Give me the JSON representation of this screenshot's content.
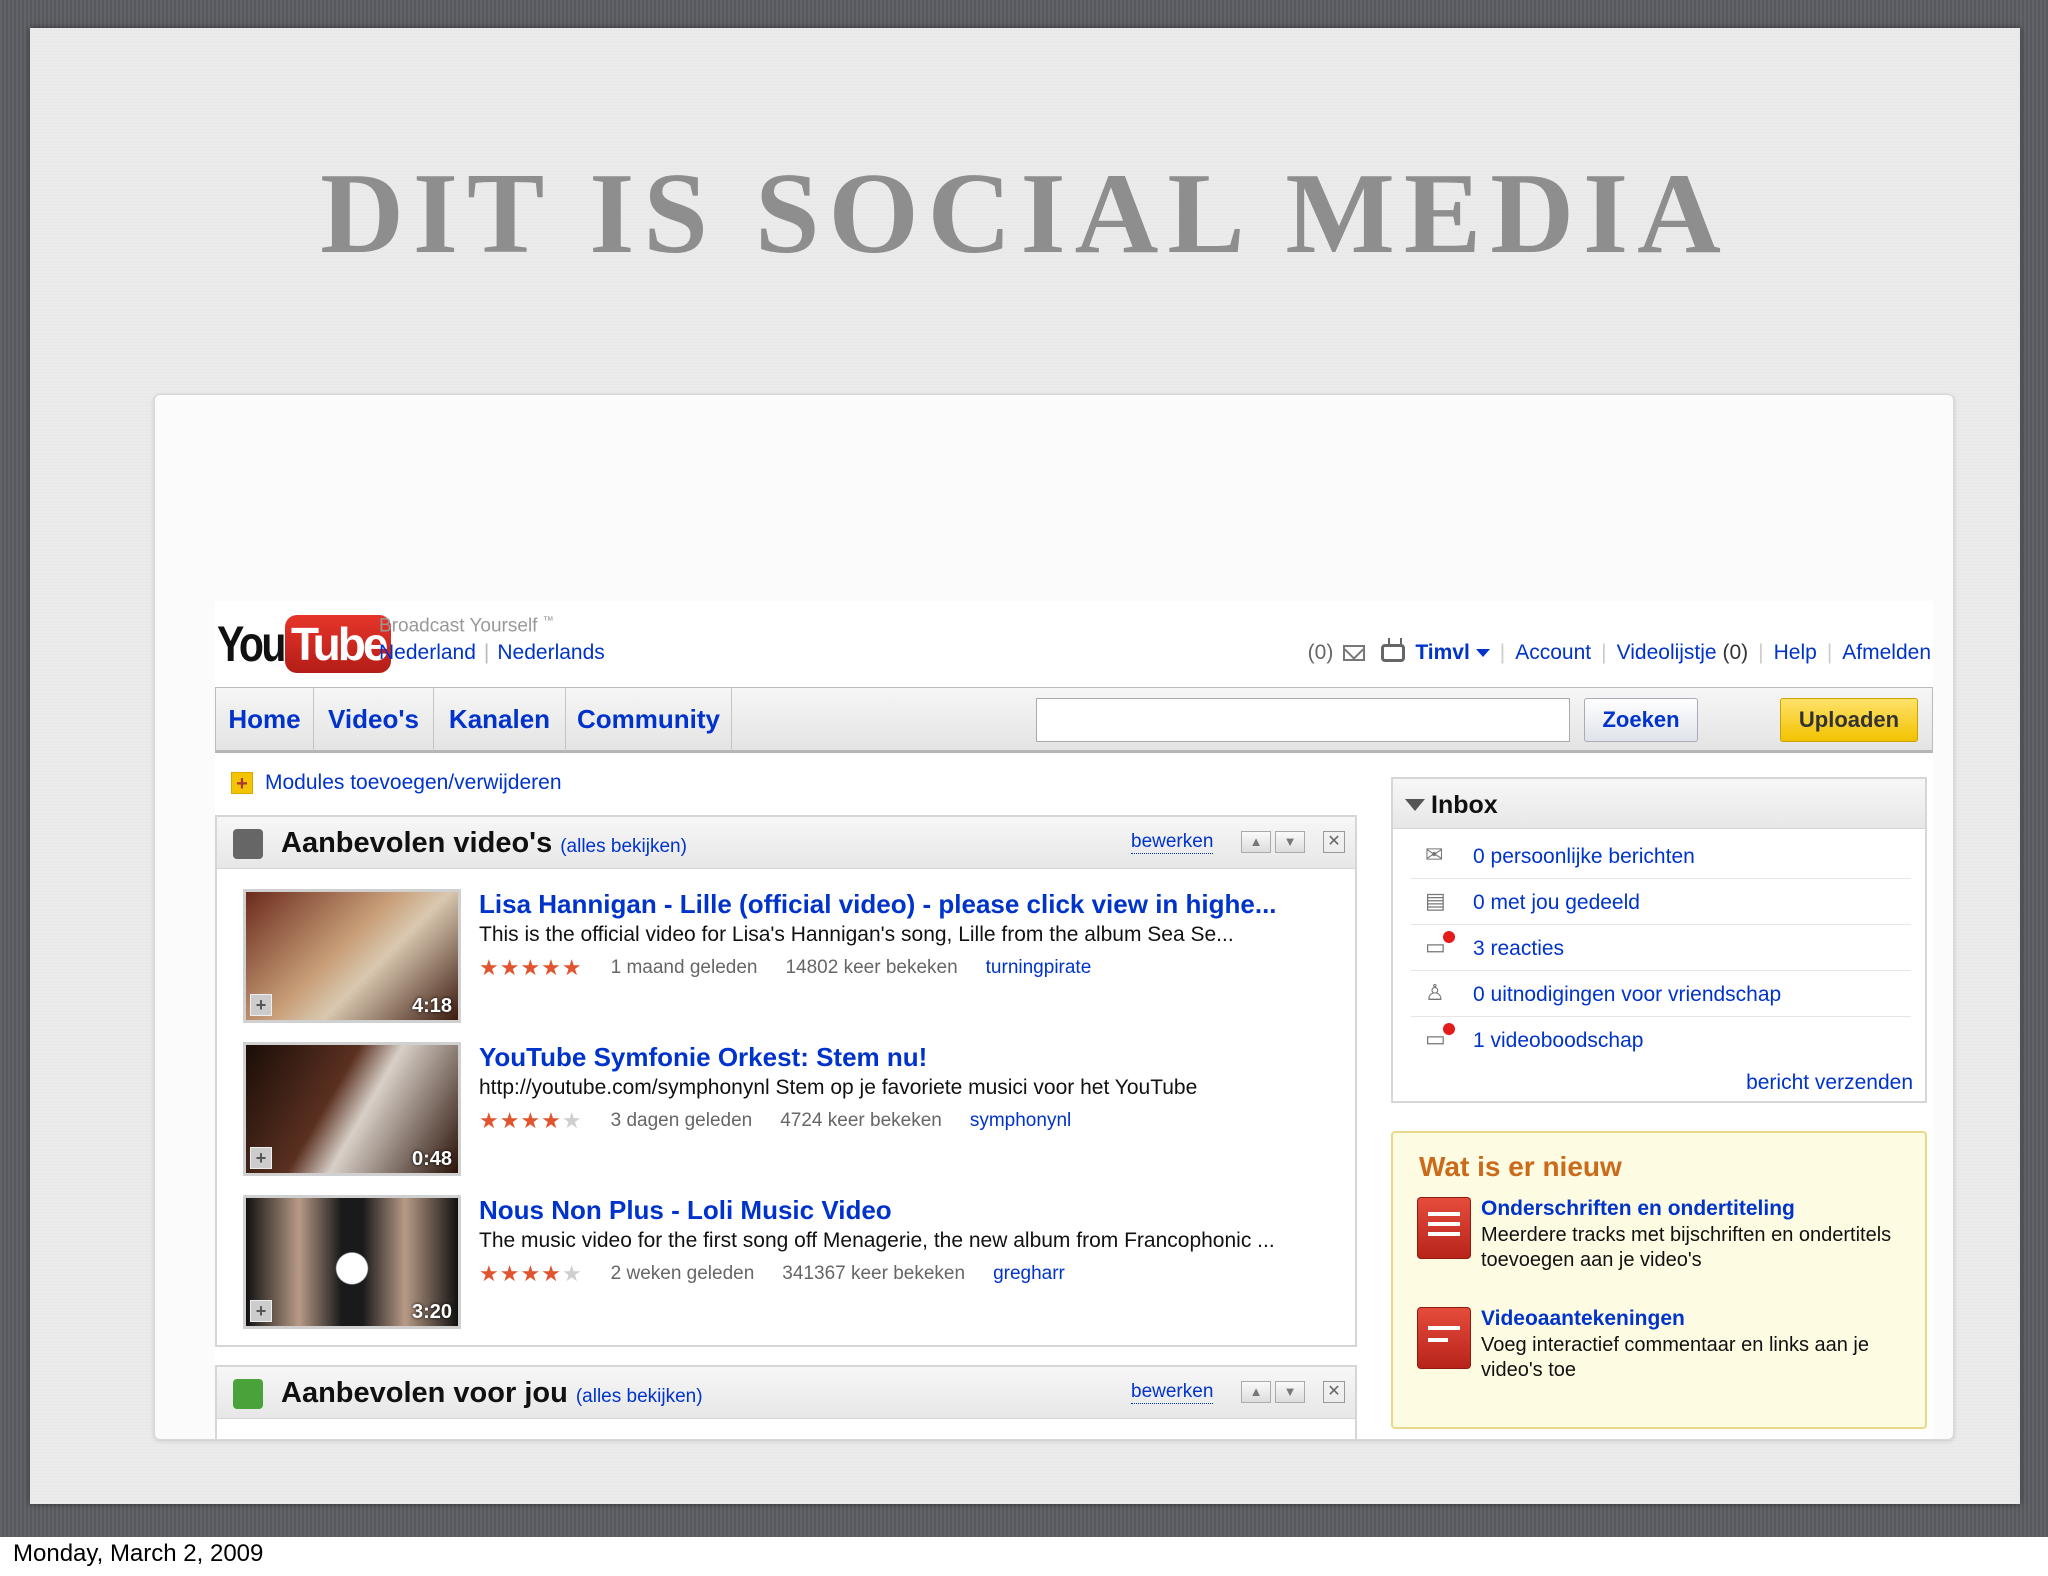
{
  "slide": {
    "title": "DIT IS SOCIAL MEDIA",
    "date": "Monday, March 2, 2009"
  },
  "header": {
    "logo": {
      "you": "You",
      "tube": "Tube"
    },
    "tagline": "Broadcast Yourself",
    "tagline_tm": "™",
    "country": "Nederland",
    "language": "Nederlands",
    "inbox_count": "(0)",
    "username": "Timvl",
    "account": "Account",
    "playlist": "Videolijstje",
    "playlist_count": "(0)",
    "help": "Help",
    "logout": "Afmelden"
  },
  "nav": {
    "tabs": [
      {
        "label": "Home"
      },
      {
        "label": "Video's"
      },
      {
        "label": "Kanalen"
      },
      {
        "label": "Community"
      }
    ],
    "search_value": "",
    "search_button": "Zoeken",
    "upload_button": "Uploaden"
  },
  "modules_link": "Modules toevoegen/verwijderen",
  "recommended": {
    "title": "Aanbevolen video's",
    "all": "(alles bekijken)",
    "edit": "bewerken",
    "videos": [
      {
        "title": "Lisa Hannigan - Lille (official video) - please click view in highe...",
        "desc": "This is the official video for Lisa's Hannigan's song, Lille from the album Sea Se...",
        "rating": 5,
        "age": "1 maand geleden",
        "views": "14802 keer bekeken",
        "user": "turningpirate",
        "duration": "4:18"
      },
      {
        "title": "YouTube Symfonie Orkest: Stem nu!",
        "desc": "http://youtube.com/symphonynl Stem op je favoriete musici voor het YouTube",
        "rating": 4.5,
        "age": "3 dagen geleden",
        "views": "4724 keer bekeken",
        "user": "symphonynl",
        "duration": "0:48"
      },
      {
        "title": "Nous Non Plus - Loli Music Video",
        "desc": "The music video for the first song off Menagerie, the new album from Francophonic ...",
        "rating": 4,
        "age": "2 weken geleden",
        "views": "341367 keer bekeken",
        "user": "gregharr",
        "duration": "3:20"
      }
    ]
  },
  "for_you": {
    "title": "Aanbevolen voor jou",
    "all": "(alles bekijken)",
    "edit": "bewerken"
  },
  "inbox": {
    "title": "Inbox",
    "rows": [
      {
        "icon": "envelope-icon",
        "text": "0 persoonlijke berichten"
      },
      {
        "icon": "shared-icon",
        "text": "0 met jou gedeeld"
      },
      {
        "icon": "comment-icon",
        "text": "3 reacties"
      },
      {
        "icon": "person-icon",
        "text": "0 uitnodigingen voor vriendschap"
      },
      {
        "icon": "comment-icon",
        "text": "1 videoboodschap"
      }
    ],
    "send": "bericht verzenden"
  },
  "whats_new": {
    "title": "Wat is er nieuw",
    "items": [
      {
        "title": "Onderschriften en ondertiteling",
        "desc": "Meerdere tracks met bijschriften en ondertitels toevoegen aan je video's"
      },
      {
        "title": "Videoaantekeningen",
        "desc": "Voeg interactief commentaar en links aan je video's toe"
      }
    ]
  },
  "colors": {
    "link": "#0033cc",
    "upload": "#f2c200",
    "star": "#e0552f",
    "news_title": "#cc6a1c",
    "logo_red": "#c4231a"
  }
}
